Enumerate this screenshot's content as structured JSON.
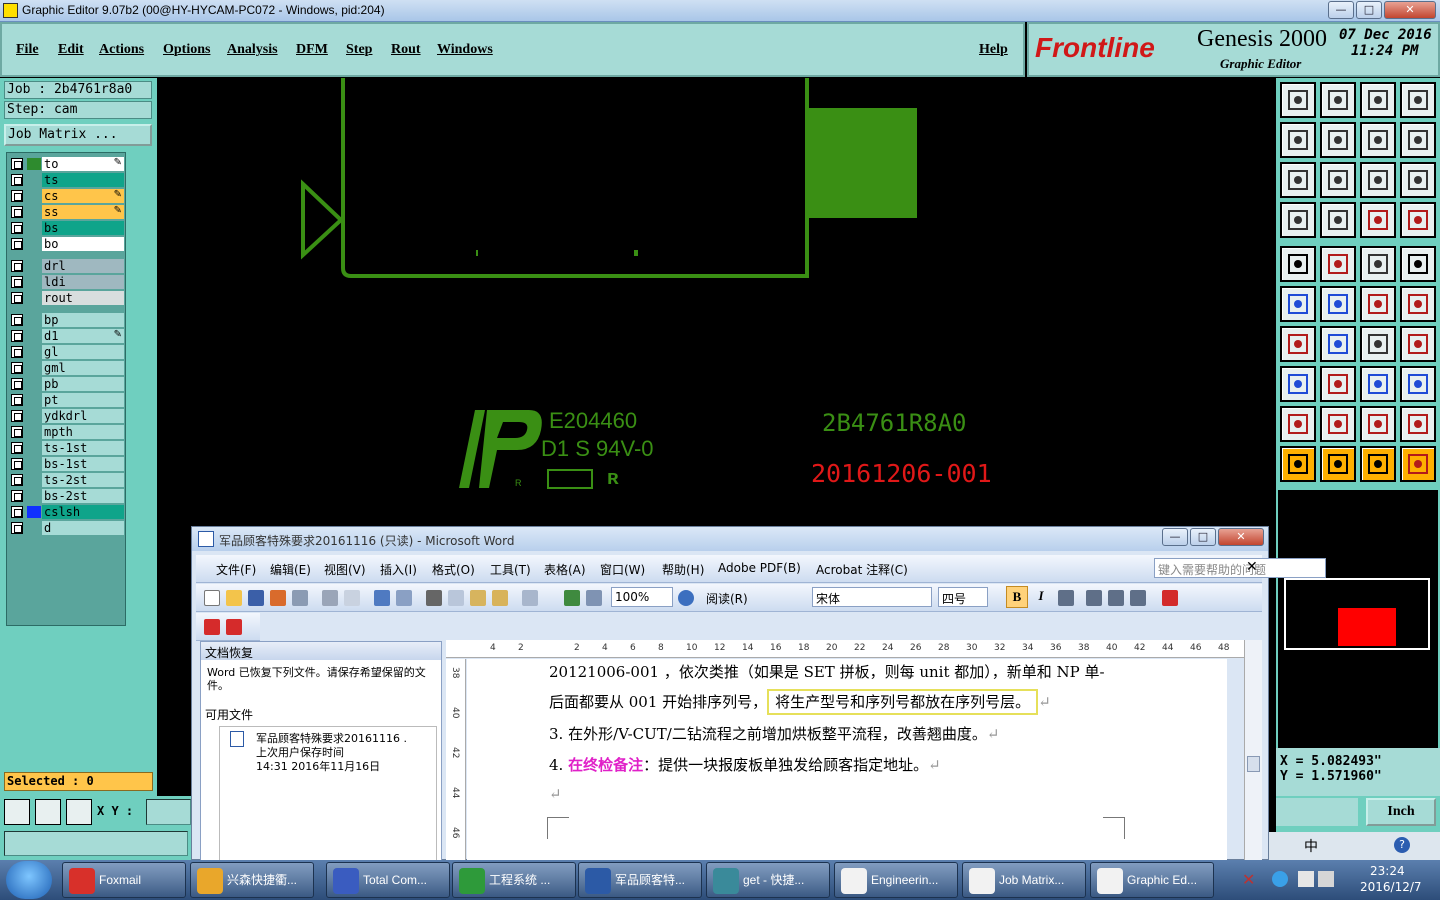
{
  "window": {
    "title": "Graphic Editor 9.07b2 (00@HY-HYCAM-PC072 - Windows, pid:204)"
  },
  "menu": [
    "File",
    "Edit",
    "Actions",
    "Options",
    "Analysis",
    "DFM",
    "Step",
    "Rout",
    "Windows"
  ],
  "help": "Help",
  "brand": {
    "logo": "Frontline",
    "product": "Genesis 2000",
    "subtitle": "Graphic Editor",
    "date": "07 Dec 2016",
    "time": "11:24 PM"
  },
  "job": {
    "job": "Job : 2b4761r8a0",
    "step": "Step: cam",
    "matrix_button": "Job Matrix ..."
  },
  "layers": [
    {
      "name": "to",
      "color": "#ffffff",
      "swatch": "#2e8b2e",
      "edit": true
    },
    {
      "name": "ts",
      "color": "#0fa48a",
      "swatch": "#5aa59c",
      "edit": false
    },
    {
      "name": "cs",
      "color": "#ffc54a",
      "swatch": "#5aa59c",
      "edit": true
    },
    {
      "name": "ss",
      "color": "#ffc54a",
      "swatch": "#5aa59c",
      "edit": true
    },
    {
      "name": "bs",
      "color": "#0fa48a",
      "swatch": "#5aa59c",
      "edit": false
    },
    {
      "name": "bo",
      "color": "#ffffff",
      "swatch": "#5aa59c",
      "edit": false
    },
    {
      "name": "drl",
      "color": "#9fb8c0",
      "swatch": "#5aa59c",
      "edit": false
    },
    {
      "name": "ldi",
      "color": "#9fb8c0",
      "swatch": "#5aa59c",
      "edit": false
    },
    {
      "name": "rout",
      "color": "#d8dede",
      "swatch": "#5aa59c",
      "edit": false
    },
    {
      "name": "bp",
      "color": "#a6dbd6",
      "swatch": "#5aa59c",
      "edit": false
    },
    {
      "name": "d1",
      "color": "#a6dbd6",
      "swatch": "#5aa59c",
      "edit": true
    },
    {
      "name": "gl",
      "color": "#a6dbd6",
      "swatch": "#5aa59c",
      "edit": false
    },
    {
      "name": "gml",
      "color": "#a6dbd6",
      "swatch": "#5aa59c",
      "edit": false
    },
    {
      "name": "pb",
      "color": "#a6dbd6",
      "swatch": "#5aa59c",
      "edit": false
    },
    {
      "name": "pt",
      "color": "#a6dbd6",
      "swatch": "#5aa59c",
      "edit": false
    },
    {
      "name": "ydkdrl",
      "color": "#a6dbd6",
      "swatch": "#5aa59c",
      "edit": false
    },
    {
      "name": "mpth",
      "color": "#a6dbd6",
      "swatch": "#5aa59c",
      "edit": false
    },
    {
      "name": "ts-1st",
      "color": "#a6dbd6",
      "swatch": "#5aa59c",
      "edit": false
    },
    {
      "name": "bs-1st",
      "color": "#a6dbd6",
      "swatch": "#5aa59c",
      "edit": false
    },
    {
      "name": "ts-2st",
      "color": "#a6dbd6",
      "swatch": "#5aa59c",
      "edit": false
    },
    {
      "name": "bs-2st",
      "color": "#a6dbd6",
      "swatch": "#5aa59c",
      "edit": false
    },
    {
      "name": "cslsh",
      "color": "#0fa48a",
      "swatch": "#1030ff",
      "edit": false
    },
    {
      "name": "d",
      "color": "#a6dbd6",
      "swatch": "#5aa59c",
      "edit": false
    }
  ],
  "selected": "Selected : 0",
  "xy_label": "X Y :",
  "canvas": {
    "ul_number": "E204460",
    "rating": "D1 S 94V-0",
    "part_number": "2B4761R8A0",
    "serial": "20161206-001",
    "ul_mark": "R"
  },
  "coords": {
    "x": "X = 5.082493\"",
    "y": "Y = 1.571960\""
  },
  "unit": "Inch",
  "word": {
    "title": "军品顾客特殊要求20161116 (只读) - Microsoft Word",
    "menus": [
      "文件(F)",
      "编辑(E)",
      "视图(V)",
      "插入(I)",
      "格式(O)",
      "工具(T)",
      "表格(A)",
      "窗口(W)",
      "帮助(H)",
      "Adobe PDF(B)",
      "Acrobat 注释(C)"
    ],
    "help_search": "键入需要帮助的问题",
    "zoom": "100%",
    "read_button": "阅读(R)",
    "font": "宋体",
    "size": "四号",
    "recovery_title": "文档恢复",
    "recovery_msg": "Word 已恢复下列文件。请保存希望保留的文件。",
    "available": "可用文件",
    "file_name": "军品顾客特殊要求20161116 .",
    "file_status": "上次用户保存时间",
    "file_time": "14:31  2016年11月16日",
    "ruler": [
      "4",
      "2",
      "",
      "2",
      "4",
      "6",
      "8",
      "10",
      "12",
      "14",
      "16",
      "18",
      "20",
      "22",
      "24",
      "26",
      "28",
      "30",
      "32",
      "34",
      "36",
      "38",
      "40",
      "42",
      "44",
      "46",
      "48"
    ],
    "vruler": [
      "38",
      "40",
      "42",
      "44",
      "46"
    ],
    "line1": "20121006-001 ，依次类推（如果是 SET 拼板，则每 unit 都加），新单和 NP 单-",
    "line2a": "后面都要从 001 开始排序列号，",
    "line2b": "将生产型号和序列号都放在序列号层。",
    "line3": "3. 在外形/V-CUT/二钻流程之前增加烘板整平流程，改善翘曲度。",
    "line4a": "4. ",
    "line4b": "在终检备注",
    "line4c": "：提供一块报废板单独发给顾客指定地址。",
    "mark": "↵"
  },
  "taskbar": {
    "items": [
      "Foxmail",
      "兴森快捷衢...",
      "Total Com...",
      "工程系统  ...",
      "军品顾客特...",
      "get - 快捷...",
      "Engineerin...",
      "Job Matrix...",
      "Graphic Ed..."
    ],
    "time": "23:24",
    "date": "2016/12/7",
    "ime": "中"
  }
}
